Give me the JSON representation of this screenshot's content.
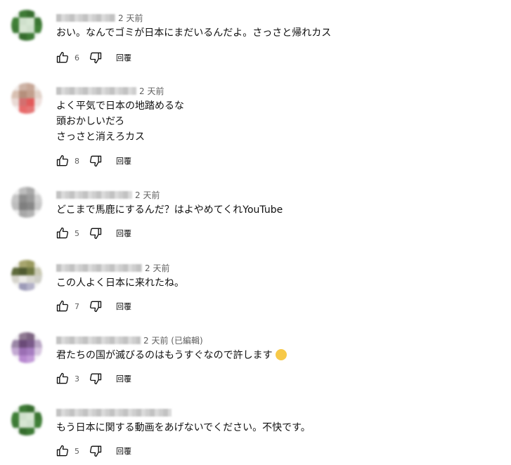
{
  "comments": [
    {
      "time": "2 天前",
      "text": "おい。なんでゴミが日本にまだいるんだよ。さっさと帰れカス",
      "likes": "6",
      "reply": "回覆",
      "avatar_colors": [
        "#e8efe8",
        "#3d7a35",
        "#356c2d",
        "#e8efe8",
        "#3f7f36",
        "#cfe0cc",
        "#d6e6d2",
        "#3a7532",
        "#3d7a35",
        "#d7e6d3",
        "#cfe0cc",
        "#3f7f36",
        "#eef3ee",
        "#356c2d",
        "#3d7a35",
        "#eef3ee"
      ]
    },
    {
      "time": "2 天前",
      "text": "よく平気で日本の地踏めるな\n頭おかしいだろ\nさっさと消えろカス",
      "likes": "8",
      "reply": "回覆",
      "avatar_colors": [
        "#efe9e6",
        "#cdb3a6",
        "#c7a797",
        "#efe9e6",
        "#d8c0b2",
        "#b58f7c",
        "#c29f8d",
        "#e1d2c9",
        "#e9d9d4",
        "#d36f6f",
        "#e25a5a",
        "#efe0dd",
        "#f5efee",
        "#e86b6b",
        "#e57676",
        "#f5efee"
      ]
    },
    {
      "time": "2 天前",
      "text": "どこまで馬鹿にするんだ？はよやめてくれYouTube",
      "likes": "5",
      "reply": "回覆",
      "avatar_colors": [
        "#eeeeee",
        "#bdbdbd",
        "#a9a9a9",
        "#eeeeee",
        "#c4c4c4",
        "#8d8d8d",
        "#9b9b9b",
        "#d0d0d0",
        "#bdbdbd",
        "#7f7f7f",
        "#888888",
        "#c8c8c8",
        "#efefef",
        "#a8a8a8",
        "#b3b3b3",
        "#efefef"
      ]
    },
    {
      "time": "2 天前",
      "text": "この人よく日本に来れたね。",
      "likes": "7",
      "reply": "回覆",
      "avatar_colors": [
        "#f0efe8",
        "#a7a56e",
        "#9a9a5e",
        "#f0efe8",
        "#5f6a3c",
        "#4f5a31",
        "#6f7842",
        "#c9c9b2",
        "#d6d4cc",
        "#ecebe8",
        "#dad9d4",
        "#cfcfc7",
        "#f2f2f0",
        "#9d9bb8",
        "#b3b1c8",
        "#f2f2f0"
      ]
    },
    {
      "time": "2 天前 (已編輯)",
      "text": "君たちの国が滅びるのはもうすぐなので許します",
      "likes": "3",
      "reply": "回覆",
      "avatar_colors": [
        "#f0edf2",
        "#8f7a92",
        "#7d6582",
        "#f0edf2",
        "#9a86a6",
        "#6a4a78",
        "#7a5a8a",
        "#b9a6c4",
        "#c3a9d2",
        "#9b6fb4",
        "#a67dc0",
        "#d7c6e0",
        "#f4f0f6",
        "#b889d0",
        "#c39bd8",
        "#f4f0f6"
      ]
    },
    {
      "time": "",
      "text": "もう日本に関する動画をあげないでください。不快です。",
      "likes": "5",
      "reply": "回覆",
      "avatar_colors": [
        "#e8efe8",
        "#3d7a35",
        "#356c2d",
        "#e8efe8",
        "#3f7f36",
        "#cfe0cc",
        "#d6e6d2",
        "#3a7532",
        "#3d7a35",
        "#d7e6d3",
        "#cfe0cc",
        "#3f7f36",
        "#eef3ee",
        "#356c2d",
        "#3d7a35",
        "#eef3ee"
      ]
    }
  ]
}
